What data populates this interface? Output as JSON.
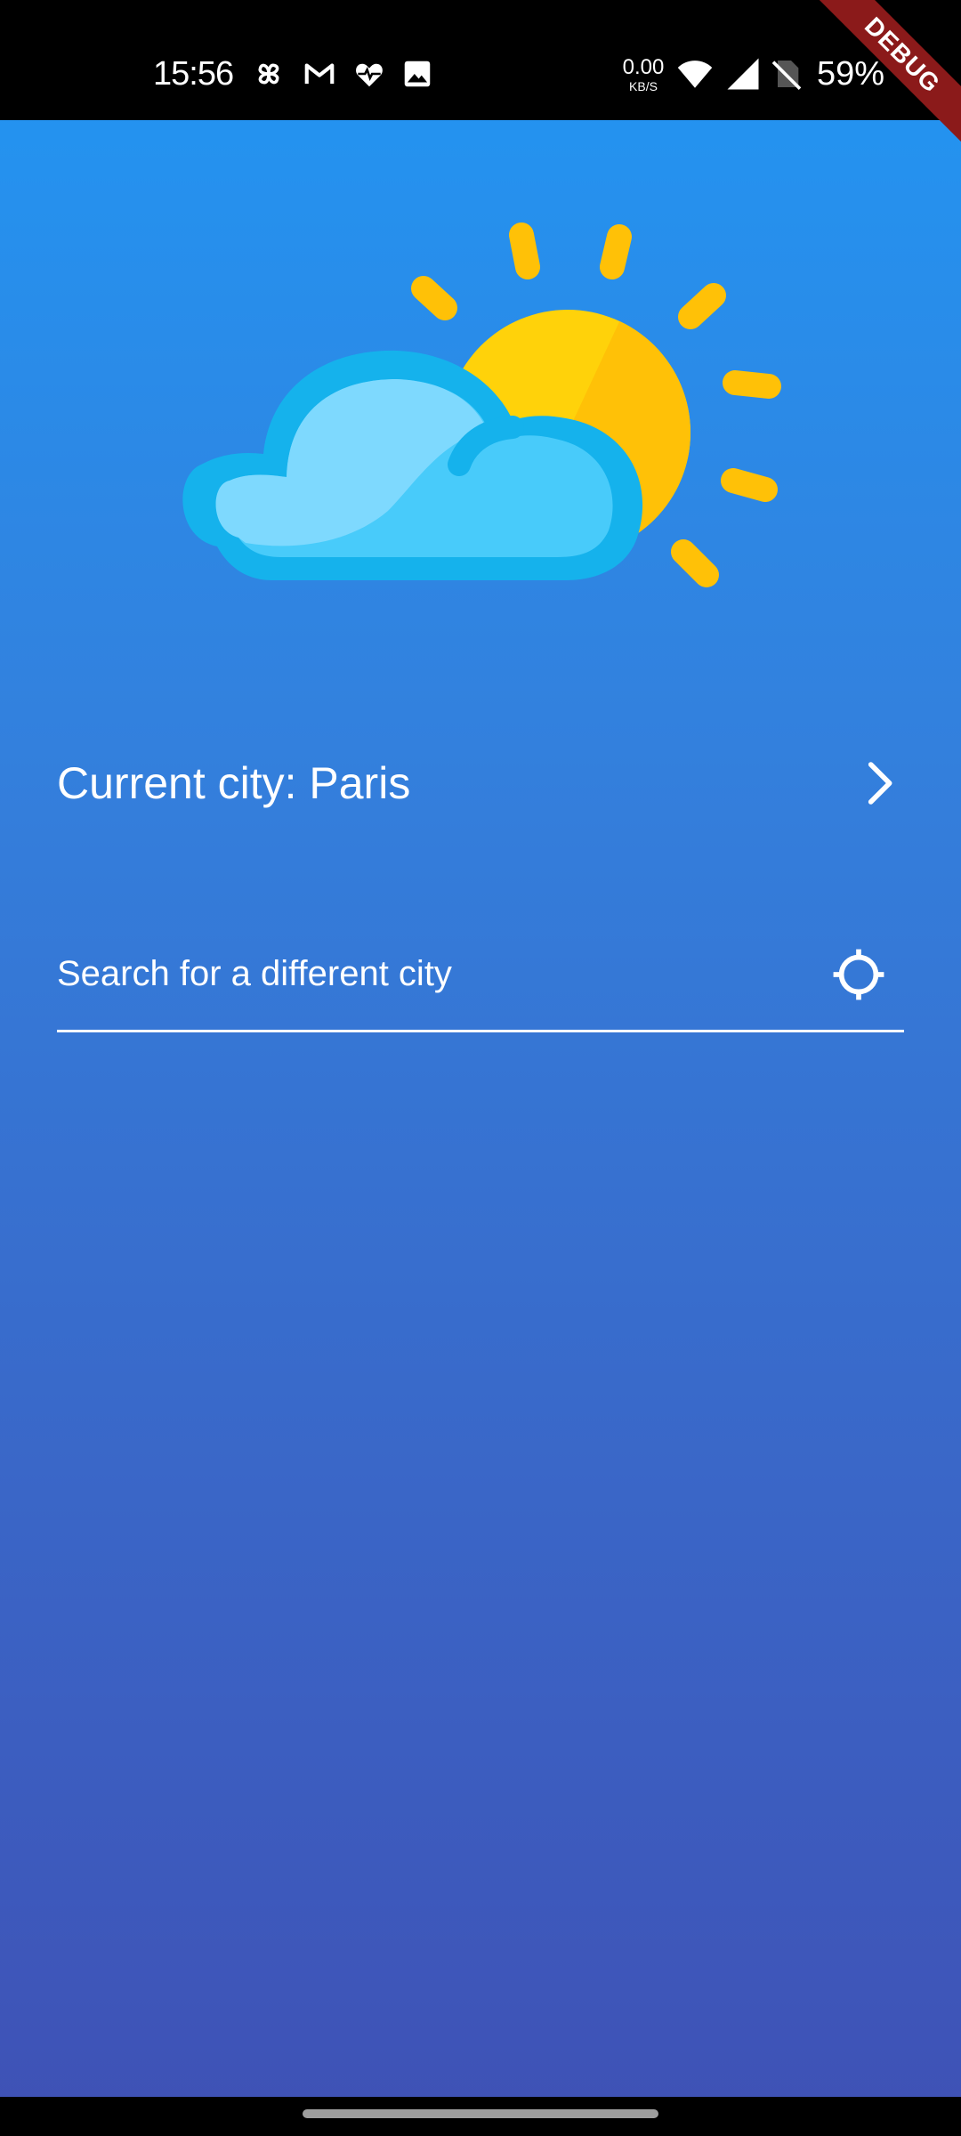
{
  "status_bar": {
    "time": "15:56",
    "notification_icons": [
      "pinwheel-icon",
      "gmail-icon",
      "heart-pulse-icon",
      "image-icon"
    ],
    "net_speed_value": "0.00",
    "net_speed_unit": "KB/S",
    "battery_percent": "59%"
  },
  "debug_banner": "DEBUG",
  "illustration": "partly-cloudy-icon",
  "current_city": {
    "label": "Current city: Paris"
  },
  "search": {
    "placeholder": "Search for a different city",
    "value": ""
  },
  "colors": {
    "gradient_top": "#2196F3",
    "gradient_bottom": "#3F51B5",
    "sun": "#FFC107",
    "cloud": "#4FC3F7",
    "debug_ribbon": "#8B1A1A"
  }
}
